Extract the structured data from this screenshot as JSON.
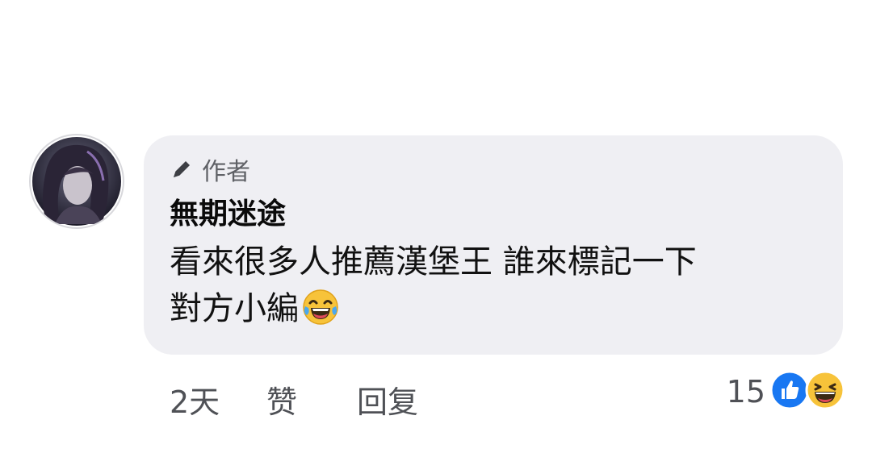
{
  "comment": {
    "author_badge": "作者",
    "author_name": "無期迷途",
    "text_line1": "看來很多人推薦漢堡王 誰來標記一下",
    "text_line2": "對方小編",
    "inline_emoji": "laughing-tears"
  },
  "actions": {
    "time": "2天",
    "like_label": "赞",
    "reply_label": "回复"
  },
  "reactions": {
    "count": "15",
    "icons": [
      "like-reaction",
      "haha-reaction"
    ]
  },
  "colors": {
    "bubble": "#efeff3",
    "like_blue": "#1877f2",
    "emoji_yellow": "#f7c33a"
  }
}
